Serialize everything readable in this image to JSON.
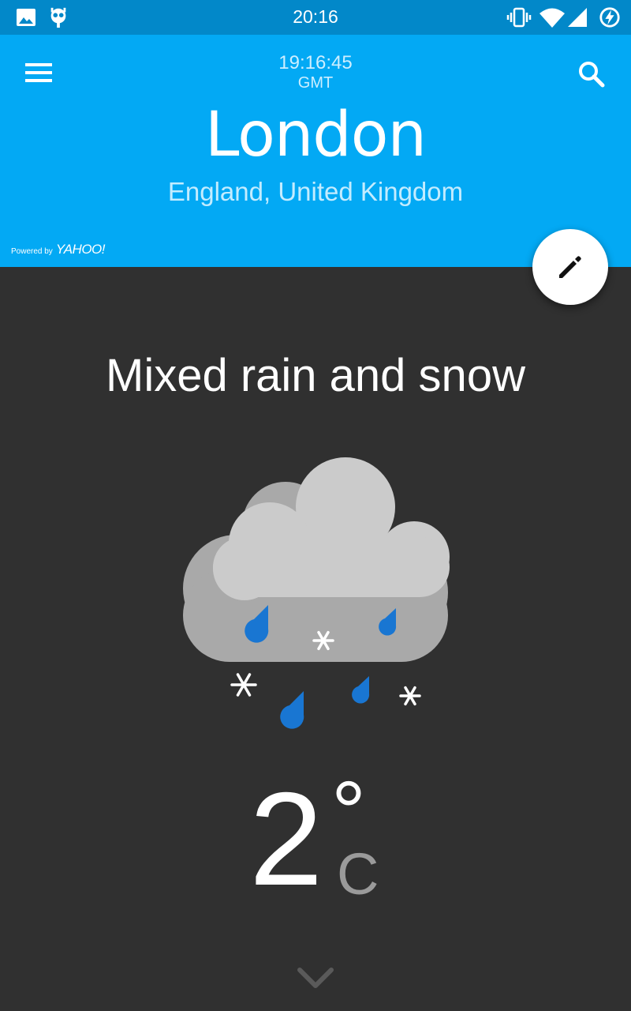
{
  "status_bar": {
    "time": "20:16",
    "icons": [
      "image-icon",
      "cyanogen-robot-icon",
      "vibrate-icon",
      "wifi-icon",
      "cellular-signal-icon",
      "battery-charging-icon"
    ]
  },
  "header": {
    "local_time": "19:16:45",
    "timezone": "GMT",
    "city": "London",
    "region": "England, United Kingdom",
    "powered_by": "Powered by",
    "provider": "YAHOO!",
    "background": "#03a9f4",
    "menu_icon": "menu-icon",
    "search_icon": "search-icon"
  },
  "fab": {
    "icon": "edit-icon"
  },
  "weather": {
    "condition": "Mixed rain and snow",
    "icon": "rain-snow-cloud-icon",
    "temperature": "2",
    "degree_symbol": "°",
    "unit": "C"
  },
  "footer": {
    "expand_icon": "chevron-down-icon"
  },
  "colors": {
    "status_bar": "#0288c9",
    "header": "#03a9f4",
    "background": "#303030",
    "raindrop": "#1976d2"
  }
}
